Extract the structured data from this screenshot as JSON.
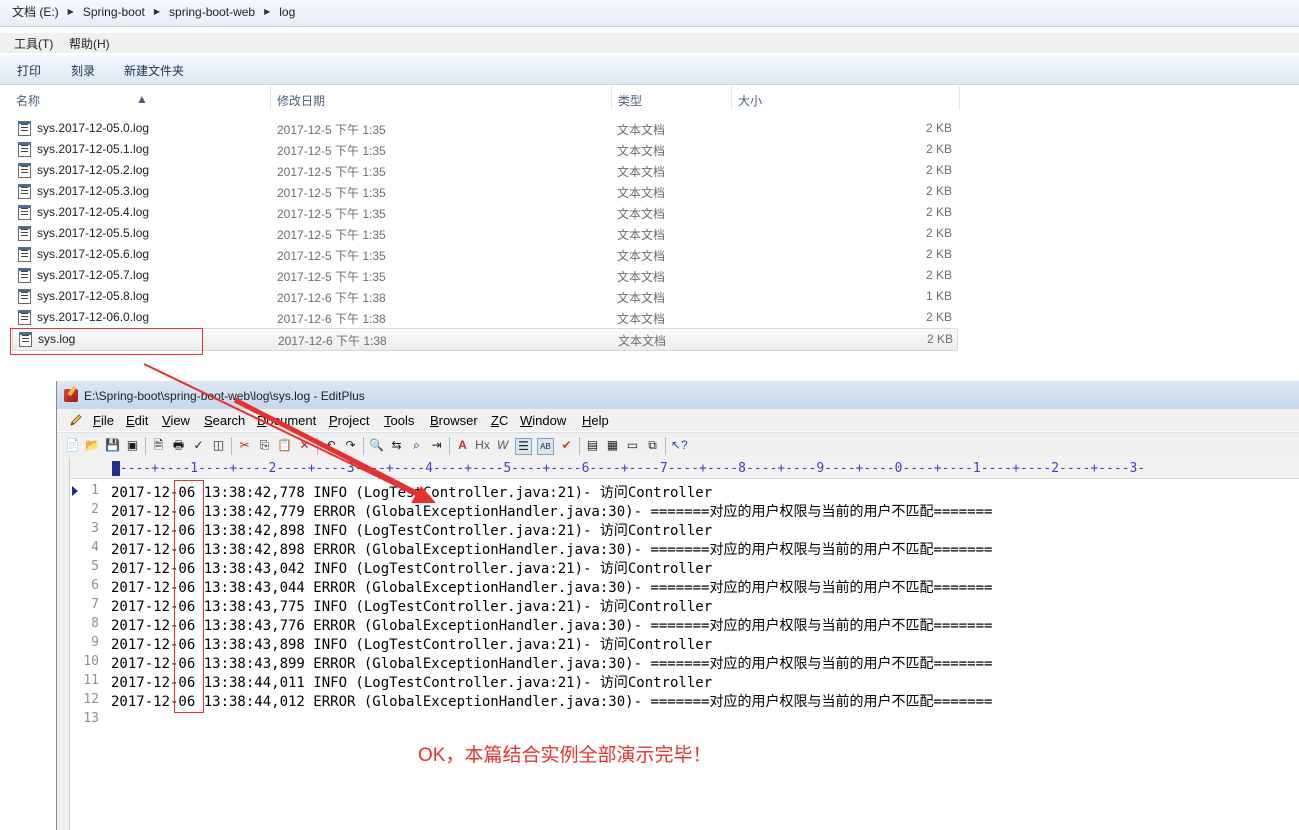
{
  "explorer": {
    "breadcrumb": [
      "文档 (E:)",
      "Spring-boot",
      "spring-boot-web",
      "log"
    ],
    "menu": [
      "工具(T)",
      "帮助(H)"
    ],
    "commands": [
      "打印",
      "刻录",
      "新建文件夹"
    ],
    "columns": {
      "name": "名称",
      "date": "修改日期",
      "type": "类型",
      "size": "大小"
    },
    "files": [
      {
        "name": "sys.2017-12-05.0.log",
        "date": "2017-12-5 下午 1:35",
        "type": "文本文档",
        "size": "2 KB"
      },
      {
        "name": "sys.2017-12-05.1.log",
        "date": "2017-12-5 下午 1:35",
        "type": "文本文档",
        "size": "2 KB"
      },
      {
        "name": "sys.2017-12-05.2.log",
        "date": "2017-12-5 下午 1:35",
        "type": "文本文档",
        "size": "2 KB"
      },
      {
        "name": "sys.2017-12-05.3.log",
        "date": "2017-12-5 下午 1:35",
        "type": "文本文档",
        "size": "2 KB"
      },
      {
        "name": "sys.2017-12-05.4.log",
        "date": "2017-12-5 下午 1:35",
        "type": "文本文档",
        "size": "2 KB"
      },
      {
        "name": "sys.2017-12-05.5.log",
        "date": "2017-12-5 下午 1:35",
        "type": "文本文档",
        "size": "2 KB"
      },
      {
        "name": "sys.2017-12-05.6.log",
        "date": "2017-12-5 下午 1:35",
        "type": "文本文档",
        "size": "2 KB"
      },
      {
        "name": "sys.2017-12-05.7.log",
        "date": "2017-12-5 下午 1:35",
        "type": "文本文档",
        "size": "2 KB"
      },
      {
        "name": "sys.2017-12-05.8.log",
        "date": "2017-12-6 下午 1:38",
        "type": "文本文档",
        "size": "1 KB"
      },
      {
        "name": "sys.2017-12-06.0.log",
        "date": "2017-12-6 下午 1:38",
        "type": "文本文档",
        "size": "2 KB"
      },
      {
        "name": "sys.log",
        "date": "2017-12-6 下午 1:38",
        "type": "文本文档",
        "size": "2 KB"
      }
    ]
  },
  "editplus": {
    "title": "E:\\Spring-boot\\spring-boot-web\\log\\sys.log - EditPlus",
    "menu": [
      {
        "ul": "F",
        "rest": "ile"
      },
      {
        "ul": "E",
        "rest": "dit"
      },
      {
        "ul": "V",
        "rest": "iew"
      },
      {
        "ul": "S",
        "rest": "earch"
      },
      {
        "ul": "D",
        "rest": "ocument"
      },
      {
        "ul": "P",
        "rest": "roject"
      },
      {
        "ul": "T",
        "rest": "ools"
      },
      {
        "ul": "B",
        "rest": "rowser"
      },
      {
        "ul": "Z",
        "rest": "C"
      },
      {
        "ul": "W",
        "rest": "indow"
      },
      {
        "ul": "H",
        "rest": "elp"
      }
    ],
    "ruler": "----+----1----+----2----+----3----+----4----+----5----+----6----+----7----+----8----+----9----+----0----+----1----+----2----+----3-",
    "lines": [
      "2017-12-06 13:38:42,778 INFO (LogTestController.java:21)- 访问Controller",
      "2017-12-06 13:38:42,779 ERROR (GlobalExceptionHandler.java:30)- =======对应的用户权限与当前的用户不匹配=======",
      "2017-12-06 13:38:42,898 INFO (LogTestController.java:21)- 访问Controller",
      "2017-12-06 13:38:42,898 ERROR (GlobalExceptionHandler.java:30)- =======对应的用户权限与当前的用户不匹配=======",
      "2017-12-06 13:38:43,042 INFO (LogTestController.java:21)- 访问Controller",
      "2017-12-06 13:38:43,044 ERROR (GlobalExceptionHandler.java:30)- =======对应的用户权限与当前的用户不匹配=======",
      "2017-12-06 13:38:43,775 INFO (LogTestController.java:21)- 访问Controller",
      "2017-12-06 13:38:43,776 ERROR (GlobalExceptionHandler.java:30)- =======对应的用户权限与当前的用户不匹配=======",
      "2017-12-06 13:38:43,898 INFO (LogTestController.java:21)- 访问Controller",
      "2017-12-06 13:38:43,899 ERROR (GlobalExceptionHandler.java:30)- =======对应的用户权限与当前的用户不匹配=======",
      "2017-12-06 13:38:44,011 INFO (LogTestController.java:21)- 访问Controller",
      "2017-12-06 13:38:44,012 ERROR (GlobalExceptionHandler.java:30)- =======对应的用户权限与当前的用户不匹配=======",
      ""
    ]
  },
  "annotation": {
    "message": "OK，本篇结合实例全部演示完毕！",
    "color": "#e83030"
  }
}
